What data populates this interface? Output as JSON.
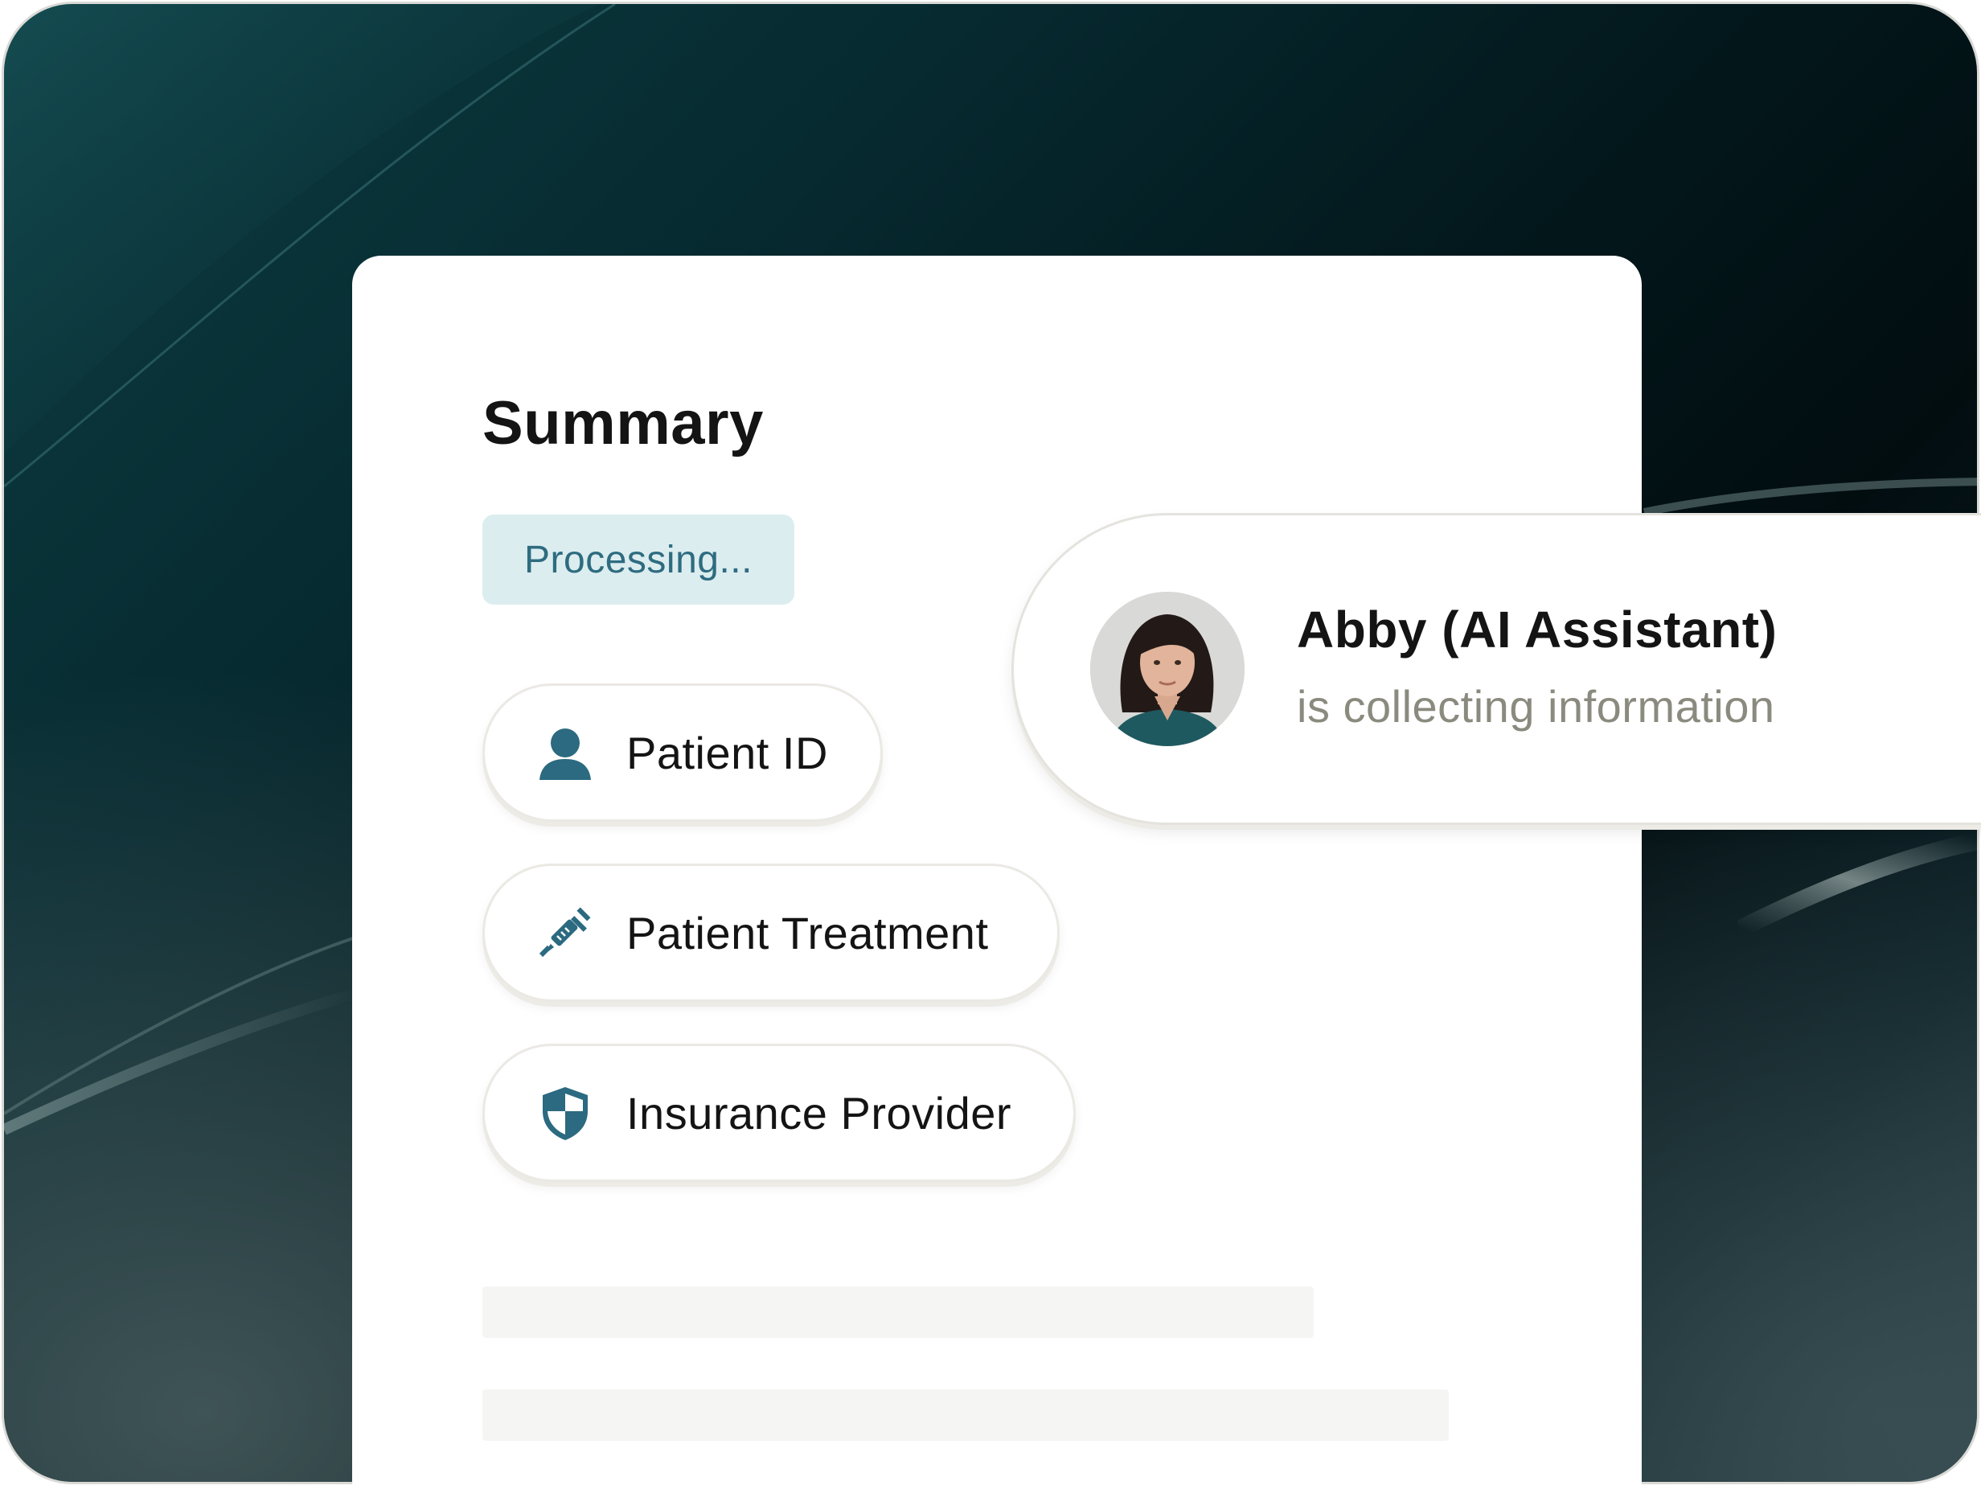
{
  "summary": {
    "title": "Summary",
    "status": "Processing..."
  },
  "items": [
    {
      "label": "Patient ID",
      "icon": "person-icon"
    },
    {
      "label": "Patient Treatment",
      "icon": "syringe-icon"
    },
    {
      "label": "Insurance Provider",
      "icon": "shield-icon"
    }
  ],
  "assistant": {
    "name": "Abby (AI Assistant)",
    "status": "is collecting information"
  },
  "colors": {
    "accent": "#2e6c80",
    "badge_bg": "#dcedef",
    "icon": "#2b6a80",
    "muted_text": "#8a8a7e"
  }
}
